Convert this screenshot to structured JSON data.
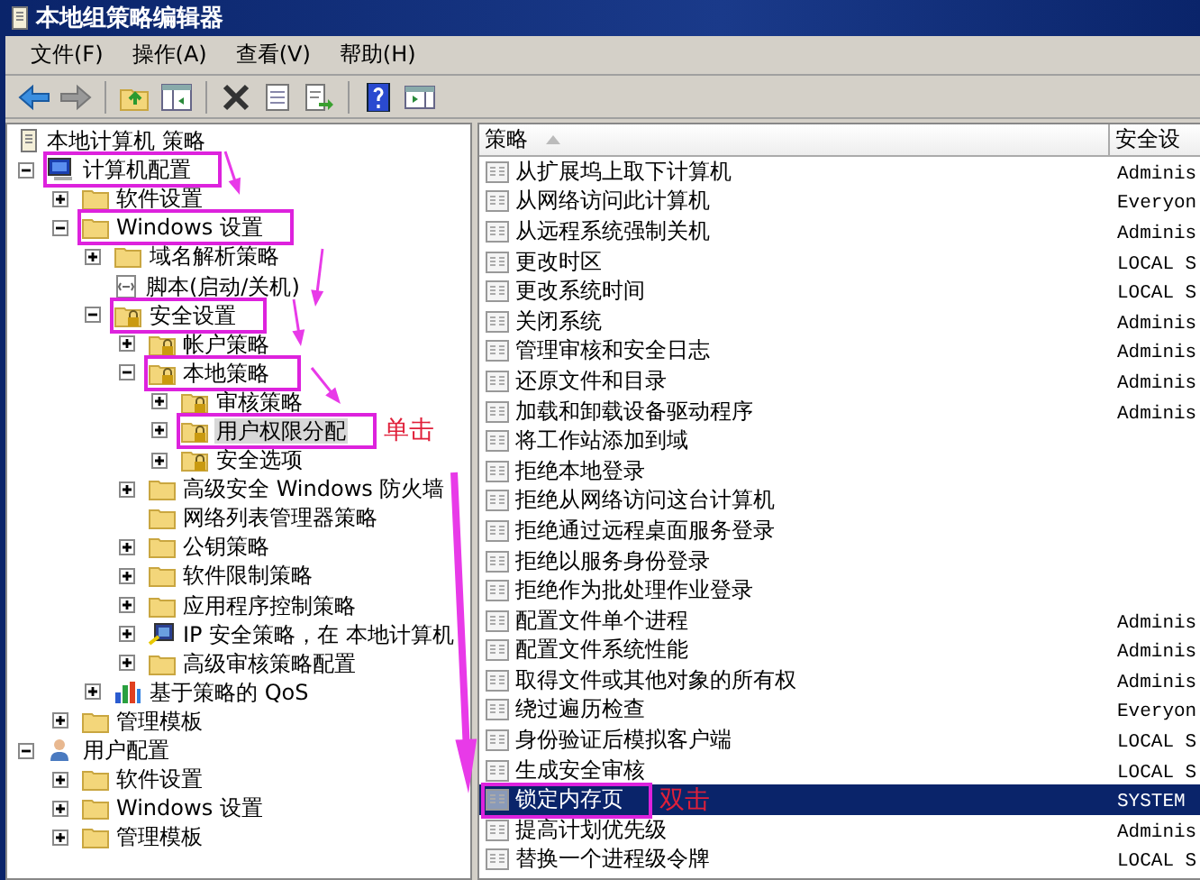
{
  "window": {
    "title": "本地组策略编辑器"
  },
  "menu": [
    {
      "label": "文件(F)"
    },
    {
      "label": "操作(A)"
    },
    {
      "label": "查看(V)"
    },
    {
      "label": "帮助(H)"
    }
  ],
  "tree": [
    {
      "label": "本地计算机 策略",
      "kind": "scroll",
      "highlighted": false,
      "selected": false,
      "children": [
        {
          "label": "计算机配置",
          "kind": "computer",
          "expanded": true,
          "highlighted": true,
          "selected": false,
          "children": [
            {
              "label": "软件设置",
              "kind": "folder",
              "expanded": false,
              "highlighted": false,
              "selected": false
            },
            {
              "label": "Windows 设置",
              "kind": "folder",
              "expanded": true,
              "highlighted": true,
              "selected": false,
              "children": [
                {
                  "label": "域名解析策略",
                  "kind": "folder",
                  "expanded": false,
                  "highlighted": false,
                  "selected": false
                },
                {
                  "label": "脚本(启动/关机)",
                  "kind": "script",
                  "highlighted": false,
                  "selected": false
                },
                {
                  "label": "安全设置",
                  "kind": "lockfolder",
                  "expanded": true,
                  "highlighted": true,
                  "selected": false,
                  "children": [
                    {
                      "label": "帐户策略",
                      "kind": "lockfolder",
                      "expanded": false,
                      "highlighted": false,
                      "selected": false
                    },
                    {
                      "label": "本地策略",
                      "kind": "lockfolder",
                      "expanded": true,
                      "highlighted": true,
                      "selected": false,
                      "children": [
                        {
                          "label": "审核策略",
                          "kind": "lockfolder",
                          "expanded": false,
                          "highlighted": false,
                          "selected": false
                        },
                        {
                          "label": "用户权限分配",
                          "kind": "lockfolder",
                          "expanded": false,
                          "highlighted": true,
                          "selected": true,
                          "note": "单击"
                        },
                        {
                          "label": "安全选项",
                          "kind": "lockfolder",
                          "expanded": false,
                          "highlighted": false,
                          "selected": false
                        }
                      ]
                    },
                    {
                      "label": "高级安全 Windows 防火墙",
                      "kind": "folder",
                      "expanded": false,
                      "highlighted": false,
                      "selected": false
                    },
                    {
                      "label": "网络列表管理器策略",
                      "kind": "folder",
                      "highlighted": false,
                      "selected": false
                    },
                    {
                      "label": "公钥策略",
                      "kind": "folder",
                      "expanded": false,
                      "highlighted": false,
                      "selected": false
                    },
                    {
                      "label": "软件限制策略",
                      "kind": "folder",
                      "expanded": false,
                      "highlighted": false,
                      "selected": false
                    },
                    {
                      "label": "应用程序控制策略",
                      "kind": "folder",
                      "expanded": false,
                      "highlighted": false,
                      "selected": false
                    },
                    {
                      "label": "IP 安全策略，在 本地计算机",
                      "kind": "ip",
                      "expanded": false,
                      "highlighted": false,
                      "selected": false
                    },
                    {
                      "label": "高级审核策略配置",
                      "kind": "folder",
                      "expanded": false,
                      "highlighted": false,
                      "selected": false
                    }
                  ]
                },
                {
                  "label": "基于策略的 QoS",
                  "kind": "chart",
                  "expanded": false,
                  "highlighted": false,
                  "selected": false
                }
              ]
            },
            {
              "label": "管理模板",
              "kind": "folder",
              "expanded": false,
              "highlighted": false,
              "selected": false
            }
          ]
        },
        {
          "label": "用户配置",
          "kind": "user",
          "expanded": true,
          "highlighted": false,
          "selected": false,
          "children": [
            {
              "label": "软件设置",
              "kind": "folder",
              "expanded": false,
              "highlighted": false,
              "selected": false
            },
            {
              "label": "Windows 设置",
              "kind": "folder",
              "expanded": false,
              "highlighted": false,
              "selected": false
            },
            {
              "label": "管理模板",
              "kind": "folder",
              "expanded": false,
              "highlighted": false,
              "selected": false
            }
          ]
        }
      ]
    }
  ],
  "list": {
    "columns": [
      {
        "label": "策略",
        "sorted": true
      },
      {
        "label": "安全设",
        "sorted": false
      }
    ],
    "rows": [
      {
        "name": "从扩展坞上取下计算机",
        "security": "Adminis",
        "selected": false,
        "highlighted": false
      },
      {
        "name": "从网络访问此计算机",
        "security": "Everyon",
        "selected": false,
        "highlighted": false
      },
      {
        "name": "从远程系统强制关机",
        "security": "Adminis",
        "selected": false,
        "highlighted": false
      },
      {
        "name": "更改时区",
        "security": "LOCAL S",
        "selected": false,
        "highlighted": false
      },
      {
        "name": "更改系统时间",
        "security": "LOCAL S",
        "selected": false,
        "highlighted": false
      },
      {
        "name": "关闭系统",
        "security": "Adminis",
        "selected": false,
        "highlighted": false
      },
      {
        "name": "管理审核和安全日志",
        "security": "Adminis",
        "selected": false,
        "highlighted": false
      },
      {
        "name": "还原文件和目录",
        "security": "Adminis",
        "selected": false,
        "highlighted": false
      },
      {
        "name": "加载和卸载设备驱动程序",
        "security": "Adminis",
        "selected": false,
        "highlighted": false
      },
      {
        "name": "将工作站添加到域",
        "selected": false,
        "highlighted": false
      },
      {
        "name": "拒绝本地登录",
        "selected": false,
        "highlighted": false
      },
      {
        "name": "拒绝从网络访问这台计算机",
        "selected": false,
        "highlighted": false
      },
      {
        "name": "拒绝通过远程桌面服务登录",
        "selected": false,
        "highlighted": false
      },
      {
        "name": "拒绝以服务身份登录",
        "selected": false,
        "highlighted": false
      },
      {
        "name": "拒绝作为批处理作业登录",
        "selected": false,
        "highlighted": false
      },
      {
        "name": "配置文件单个进程",
        "security": "Adminis",
        "selected": false,
        "highlighted": false
      },
      {
        "name": "配置文件系统性能",
        "security": "Adminis",
        "selected": false,
        "highlighted": false
      },
      {
        "name": "取得文件或其他对象的所有权",
        "security": "Adminis",
        "selected": false,
        "highlighted": false
      },
      {
        "name": "绕过遍历检查",
        "security": "Everyon",
        "selected": false,
        "highlighted": false
      },
      {
        "name": "身份验证后模拟客户端",
        "security": "LOCAL S",
        "selected": false,
        "highlighted": false
      },
      {
        "name": "生成安全审核",
        "security": "LOCAL S",
        "selected": false,
        "highlighted": false
      },
      {
        "name": "锁定内存页",
        "security": "SYSTEM",
        "selected": true,
        "highlighted": true,
        "note": "双击"
      },
      {
        "name": "提高计划优先级",
        "security": "Adminis",
        "selected": false,
        "highlighted": false
      },
      {
        "name": "替换一个进程级令牌",
        "security": "LOCAL S",
        "selected": false,
        "highlighted": false
      }
    ]
  }
}
